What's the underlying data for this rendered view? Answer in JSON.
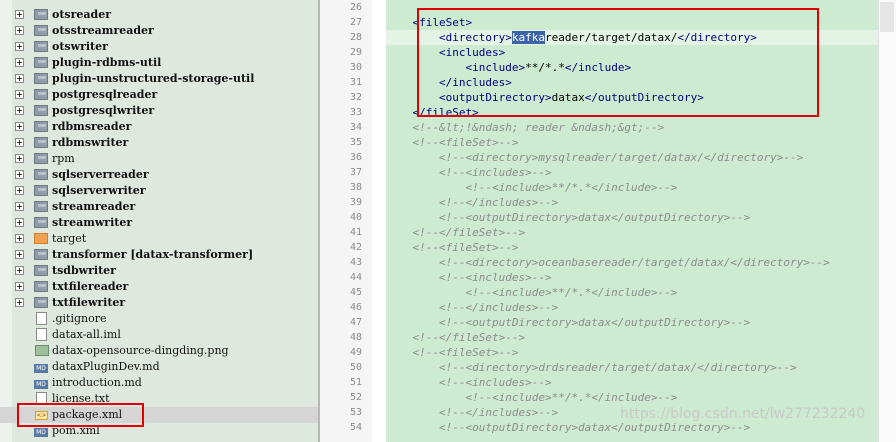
{
  "project_tree": {
    "items": [
      {
        "label": "otsreader",
        "kind": "folder",
        "expandable": true,
        "bold": true
      },
      {
        "label": "otsstreamreader",
        "kind": "folder",
        "expandable": true,
        "bold": true
      },
      {
        "label": "otswriter",
        "kind": "folder",
        "expandable": true,
        "bold": true
      },
      {
        "label": "plugin-rdbms-util",
        "kind": "folder",
        "expandable": true,
        "bold": true
      },
      {
        "label": "plugin-unstructured-storage-util",
        "kind": "folder",
        "expandable": true,
        "bold": true
      },
      {
        "label": "postgresqlreader",
        "kind": "folder",
        "expandable": true,
        "bold": true
      },
      {
        "label": "postgresqlwriter",
        "kind": "folder",
        "expandable": true,
        "bold": true
      },
      {
        "label": "rdbmsreader",
        "kind": "folder",
        "expandable": true,
        "bold": true
      },
      {
        "label": "rdbmswriter",
        "kind": "folder",
        "expandable": true,
        "bold": true
      },
      {
        "label": "rpm",
        "kind": "folder",
        "expandable": true,
        "bold": false
      },
      {
        "label": "sqlserverreader",
        "kind": "folder",
        "expandable": true,
        "bold": true
      },
      {
        "label": "sqlserverwriter",
        "kind": "folder",
        "expandable": true,
        "bold": true
      },
      {
        "label": "streamreader",
        "kind": "folder",
        "expandable": true,
        "bold": true
      },
      {
        "label": "streamwriter",
        "kind": "folder",
        "expandable": true,
        "bold": true
      },
      {
        "label": "target",
        "kind": "folder-orange",
        "expandable": true,
        "bold": false
      },
      {
        "label": "transformer [datax-transformer]",
        "kind": "folder",
        "expandable": true,
        "bold": true
      },
      {
        "label": "tsdbwriter",
        "kind": "folder",
        "expandable": true,
        "bold": true
      },
      {
        "label": "txtfilereader",
        "kind": "folder",
        "expandable": true,
        "bold": true
      },
      {
        "label": "txtfilewriter",
        "kind": "folder",
        "expandable": true,
        "bold": true
      },
      {
        "label": ".gitignore",
        "kind": "file",
        "expandable": false,
        "bold": false
      },
      {
        "label": "datax-all.iml",
        "kind": "file",
        "expandable": false,
        "bold": false
      },
      {
        "label": "datax-opensource-dingding.png",
        "kind": "img",
        "expandable": false,
        "bold": false
      },
      {
        "label": "dataxPluginDev.md",
        "kind": "md",
        "expandable": false,
        "bold": false
      },
      {
        "label": "introduction.md",
        "kind": "md",
        "expandable": false,
        "bold": false
      },
      {
        "label": "license.txt",
        "kind": "file",
        "expandable": false,
        "bold": false
      },
      {
        "label": "package.xml",
        "kind": "xml",
        "expandable": false,
        "bold": false,
        "selected": true
      },
      {
        "label": "pom.xml",
        "kind": "md",
        "expandable": false,
        "bold": false
      }
    ]
  },
  "editor": {
    "lines": [
      {
        "n": "26",
        "indent": "",
        "parts": []
      },
      {
        "n": "27",
        "indent": "",
        "parts": [
          {
            "t": "tag",
            "s": "<fileSet>"
          }
        ]
      },
      {
        "n": "28",
        "indent": "    ",
        "current": true,
        "parts": [
          {
            "t": "tag",
            "s": "<directory>"
          },
          {
            "t": "hl",
            "s": "kafka"
          },
          {
            "t": "txt",
            "s": "reader/target/datax/"
          },
          {
            "t": "tag",
            "s": "</directory>"
          }
        ]
      },
      {
        "n": "29",
        "indent": "    ",
        "parts": [
          {
            "t": "tag",
            "s": "<includes>"
          }
        ]
      },
      {
        "n": "30",
        "indent": "        ",
        "parts": [
          {
            "t": "tag",
            "s": "<include>"
          },
          {
            "t": "txt",
            "s": "**/*.*"
          },
          {
            "t": "tag",
            "s": "</include>"
          }
        ]
      },
      {
        "n": "31",
        "indent": "    ",
        "parts": [
          {
            "t": "tag",
            "s": "</includes>"
          }
        ]
      },
      {
        "n": "32",
        "indent": "    ",
        "parts": [
          {
            "t": "tag",
            "s": "<outputDirectory>"
          },
          {
            "t": "txt",
            "s": "datax"
          },
          {
            "t": "tag",
            "s": "</outputDirectory>"
          }
        ]
      },
      {
        "n": "33",
        "indent": "",
        "parts": [
          {
            "t": "tag",
            "s": "</fileSet>"
          }
        ]
      },
      {
        "n": "34",
        "indent": "",
        "parts": [
          {
            "t": "cmt",
            "s": "<!--&lt;!&ndash; reader &ndash;&gt;-->"
          }
        ]
      },
      {
        "n": "35",
        "indent": "",
        "parts": [
          {
            "t": "cmt",
            "s": "<!--<fileSet>-->"
          }
        ]
      },
      {
        "n": "36",
        "indent": "    ",
        "parts": [
          {
            "t": "cmt",
            "s": "<!--<directory>mysqlreader/target/datax/</directory>-->"
          }
        ]
      },
      {
        "n": "37",
        "indent": "    ",
        "parts": [
          {
            "t": "cmt",
            "s": "<!--<includes>-->"
          }
        ]
      },
      {
        "n": "38",
        "indent": "        ",
        "parts": [
          {
            "t": "cmt",
            "s": "<!--<include>**/*.*</include>-->"
          }
        ]
      },
      {
        "n": "39",
        "indent": "    ",
        "parts": [
          {
            "t": "cmt",
            "s": "<!--</includes>-->"
          }
        ]
      },
      {
        "n": "40",
        "indent": "    ",
        "parts": [
          {
            "t": "cmt",
            "s": "<!--<outputDirectory>datax</outputDirectory>-->"
          }
        ]
      },
      {
        "n": "41",
        "indent": "",
        "parts": [
          {
            "t": "cmt",
            "s": "<!--</fileSet>-->"
          }
        ]
      },
      {
        "n": "42",
        "indent": "",
        "parts": [
          {
            "t": "cmt",
            "s": "<!--<fileSet>-->"
          }
        ]
      },
      {
        "n": "43",
        "indent": "    ",
        "parts": [
          {
            "t": "cmt",
            "s": "<!--<directory>oceanbasereader/target/datax/</directory>-->"
          }
        ]
      },
      {
        "n": "44",
        "indent": "    ",
        "parts": [
          {
            "t": "cmt",
            "s": "<!--<includes>-->"
          }
        ]
      },
      {
        "n": "45",
        "indent": "        ",
        "parts": [
          {
            "t": "cmt",
            "s": "<!--<include>**/*.*</include>-->"
          }
        ]
      },
      {
        "n": "46",
        "indent": "    ",
        "parts": [
          {
            "t": "cmt",
            "s": "<!--</includes>-->"
          }
        ]
      },
      {
        "n": "47",
        "indent": "    ",
        "parts": [
          {
            "t": "cmt",
            "s": "<!--<outputDirectory>datax</outputDirectory>-->"
          }
        ]
      },
      {
        "n": "48",
        "indent": "",
        "parts": [
          {
            "t": "cmt",
            "s": "<!--</fileSet>-->"
          }
        ]
      },
      {
        "n": "49",
        "indent": "",
        "parts": [
          {
            "t": "cmt",
            "s": "<!--<fileSet>-->"
          }
        ]
      },
      {
        "n": "50",
        "indent": "    ",
        "parts": [
          {
            "t": "cmt",
            "s": "<!--<directory>drdsreader/target/datax/</directory>-->"
          }
        ]
      },
      {
        "n": "51",
        "indent": "    ",
        "parts": [
          {
            "t": "cmt",
            "s": "<!--<includes>-->"
          }
        ]
      },
      {
        "n": "52",
        "indent": "        ",
        "parts": [
          {
            "t": "cmt",
            "s": "<!--<include>**/*.*</include>-->"
          }
        ]
      },
      {
        "n": "53",
        "indent": "    ",
        "parts": [
          {
            "t": "cmt",
            "s": "<!--</includes>-->"
          }
        ]
      },
      {
        "n": "54",
        "indent": "    ",
        "parts": [
          {
            "t": "cmt",
            "s": "<!--<outputDirectory>datax</outputDirectory>-->"
          }
        ]
      }
    ]
  },
  "watermark": "https://blog.csdn.net/lw277232240",
  "colors": {
    "tree_bg": "#dfe8df",
    "editor_bg": "#ccebd0",
    "tag": "#000080",
    "comment": "#8d8d8d",
    "highlight": "#3d63a8",
    "annotation_box": "#e00000"
  }
}
